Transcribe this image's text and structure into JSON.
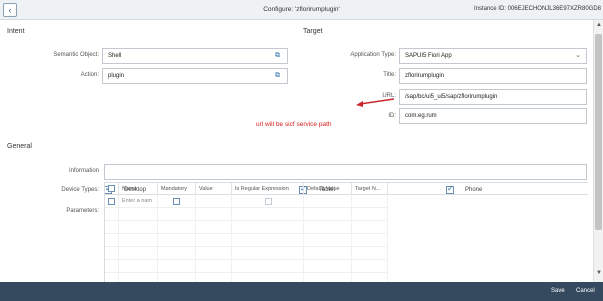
{
  "header": {
    "back_icon": "chevron-left-icon",
    "title": "Configure: 'zflorirumplugin'",
    "instance_id": "Instance ID: 006EJECHONJL36E97XZR80GD8"
  },
  "intent": {
    "section_label": "Intent",
    "semantic_object_label": "Semantic Object:",
    "semantic_object_value": "Shell",
    "action_label": "Action:",
    "action_value": "plugin",
    "value_help_icon": "value-help-icon"
  },
  "target": {
    "section_label": "Target",
    "application_type_label": "Application Type:",
    "application_type_value": "SAPUI5 Fiori App",
    "title_label": "Title:",
    "title_value": "zflorirumplugin",
    "url_label": "URL:",
    "url_value": "/sap/bc/ui5_ui5/sap/zflorirumplugin",
    "id_label": "ID:",
    "id_value": "com.eg.rum"
  },
  "annotation": {
    "text": "url will be sicf service path",
    "color": "#d3201b"
  },
  "general": {
    "section_label": "General",
    "information_label": "Information",
    "information_value": "",
    "device_types_label": "Device Types:",
    "devices": [
      {
        "label": "Desktop",
        "checked": true
      },
      {
        "label": "Tablet",
        "checked": true
      },
      {
        "label": "Phone",
        "checked": true
      }
    ],
    "parameters_label": "Parameters:"
  },
  "parameters_table": {
    "columns": [
      "Name",
      "Mandatory",
      "Value",
      "Is Regular Expression",
      "Default Value",
      "Target N..."
    ],
    "row_placeholder": "Enter a nam"
  },
  "footer": {
    "save_label": "Save",
    "cancel_label": "Cancel",
    "background": "#354a5f"
  }
}
